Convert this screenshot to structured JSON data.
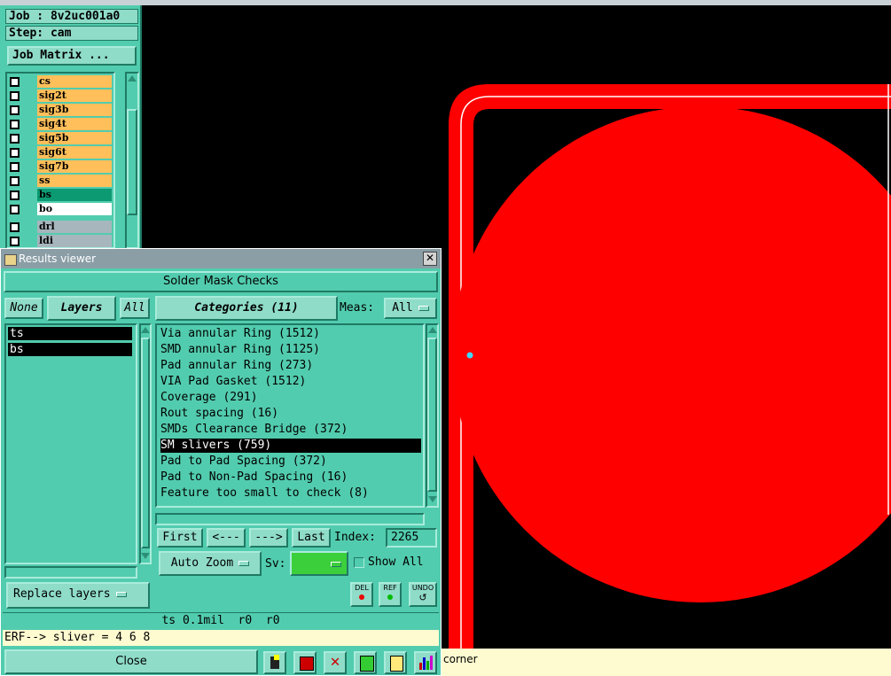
{
  "job_panel": {
    "job_label": "Job : 8v2uc001a0",
    "step_label": "Step: cam",
    "matrix_button": "Job Matrix ...",
    "layers": [
      {
        "name": "cs",
        "color": "#ffbf5a",
        "checked": false
      },
      {
        "name": "sig2t",
        "color": "#ffbf5a",
        "checked": false
      },
      {
        "name": "sig3b",
        "color": "#ffbf5a",
        "checked": false
      },
      {
        "name": "sig4t",
        "color": "#ffbf5a",
        "checked": false
      },
      {
        "name": "sig5b",
        "color": "#ffbf5a",
        "checked": false
      },
      {
        "name": "sig6t",
        "color": "#ffbf5a",
        "checked": false
      },
      {
        "name": "sig7b",
        "color": "#ffbf5a",
        "checked": false
      },
      {
        "name": "ss",
        "color": "#ffbf5a",
        "checked": false
      },
      {
        "name": "bs",
        "color": "#0c9a72",
        "checked": false
      },
      {
        "name": "bo",
        "color": "#ffffff",
        "checked": false
      },
      {
        "name": "drl",
        "color": "#a7b6bc",
        "checked": false
      },
      {
        "name": "ldi",
        "color": "#a7b6bc",
        "checked": false
      }
    ]
  },
  "results_viewer": {
    "title": "Results viewer",
    "header": "Solder Mask Checks",
    "none_btn": "None",
    "layers_btn": "Layers",
    "all_btn": "All",
    "layers_list": [
      "ts",
      "bs"
    ],
    "categories_btn": "Categories (11)",
    "meas_label": "Meas:",
    "meas_value": "All",
    "categories": [
      "Via annular Ring (1512)",
      "SMD annular Ring (1125)",
      "Pad annular Ring (273)",
      "VIA Pad Gasket (1512)",
      "Coverage (291)",
      "Rout spacing (16)",
      "SMDs Clearance Bridge (372)",
      "SM slivers (759)",
      "Pad to Pad Spacing (372)",
      "Pad to Non-Pad Spacing (16)",
      "Feature too small to check (8)"
    ],
    "selected_category_index": 7,
    "nav": {
      "first": "First",
      "prev": "<---",
      "next": "--->",
      "last": "Last",
      "index_label": "Index:",
      "index_value": "2265"
    },
    "auto_zoom": "Auto Zoom",
    "sv_label": "Sv:",
    "show_all": "Show All",
    "replace_layers": "Replace layers",
    "del_btn": "DEL",
    "ref_btn": "REF",
    "undo_btn": "UNDO",
    "status_line": "ts 0.1mil  r0  r0",
    "erf_line": "ERF--> sliver = 4 6 8",
    "close_btn": "Close"
  },
  "bottom_bar": {
    "hint_text": "corner"
  },
  "colors": {
    "panel": "#52ccae",
    "feature": "#ff0000",
    "canvas": "#000000"
  }
}
